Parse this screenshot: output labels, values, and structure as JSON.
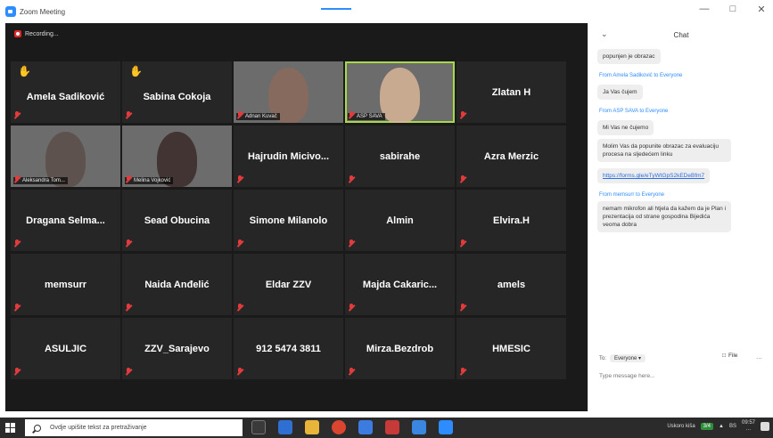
{
  "window": {
    "title": "Zoom Meeting"
  },
  "recording": {
    "label": "Recording..."
  },
  "tiles": [
    {
      "name": "Amela Sadiković",
      "hand": true,
      "video": false
    },
    {
      "name": "Sabina Cokoja",
      "hand": true,
      "video": false
    },
    {
      "name": "Adnan Kuvač",
      "video": true,
      "style": "v1"
    },
    {
      "name": "ASP SAVA",
      "video": true,
      "style": "v2",
      "active": true
    },
    {
      "name": "Zlatan H",
      "video": false
    },
    {
      "name": "Aleksandra Tom...",
      "video": true,
      "style": "v3"
    },
    {
      "name": "Melina Vojković",
      "video": true,
      "style": "v4"
    },
    {
      "name": "Hajrudin Micivo...",
      "video": false
    },
    {
      "name": "sabirahe",
      "video": false
    },
    {
      "name": "Azra Merzic",
      "video": false
    },
    {
      "name": "Dragana Selma...",
      "video": false
    },
    {
      "name": "Sead Obucina",
      "video": false
    },
    {
      "name": "Simone Milanolo",
      "video": false
    },
    {
      "name": "Almin",
      "video": false
    },
    {
      "name": "Elvira.H",
      "video": false
    },
    {
      "name": "memsurr",
      "video": false
    },
    {
      "name": "Naida Anđelić",
      "video": false
    },
    {
      "name": "Eldar ZZV",
      "video": false
    },
    {
      "name": "Majda Cakaric...",
      "video": false
    },
    {
      "name": "amels",
      "video": false
    },
    {
      "name": "ASULJIC",
      "video": false
    },
    {
      "name": "ZZV_Sarajevo",
      "video": false
    },
    {
      "name": "912 5474 3811",
      "video": false
    },
    {
      "name": "Mirza.Bezdrob",
      "video": false
    },
    {
      "name": "HMESIC",
      "video": false
    }
  ],
  "chat": {
    "title": "Chat",
    "messages": [
      {
        "type": "msg",
        "text": "popunjen je obrazac"
      },
      {
        "type": "from",
        "text": "From Amela Sadiković to Everyone"
      },
      {
        "type": "msg",
        "text": "Ja Vas čujem"
      },
      {
        "type": "from",
        "text": "From ASP SAVA to Everyone"
      },
      {
        "type": "msg",
        "text": "Mi Vas ne čujemo"
      },
      {
        "type": "msg",
        "text": "Molim Vas da popunite obrazac za evaluaciju procesa na sljedećem linku"
      },
      {
        "type": "link",
        "text": "https://forms.gle/eTyWtGpS2kEDeBfm7"
      },
      {
        "type": "from",
        "text": "From memsurr to Everyone"
      },
      {
        "type": "msg",
        "text": "nemam mikrofon ali htjela da kažem da je Plan i prezentacija od strane gospodina Bijedića veoma dobra"
      }
    ],
    "to_label": "To:",
    "to_value": "Everyone",
    "file_label": "File",
    "more_label": "...",
    "input_placeholder": "Type message here..."
  },
  "taskbar": {
    "search_placeholder": "Ovdje upišite tekst za pretraživanje",
    "weather": "Uskoro kiša",
    "badge": "3/4",
    "lang": "BS",
    "time": "09:57",
    "date": "…"
  },
  "colors": {
    "meeting_bg": "#1a1a1a",
    "tile_bg": "#262626",
    "active_speaker": "#a8d94a",
    "mute_red": "#e23b3b",
    "link_blue": "#2d8cff"
  }
}
